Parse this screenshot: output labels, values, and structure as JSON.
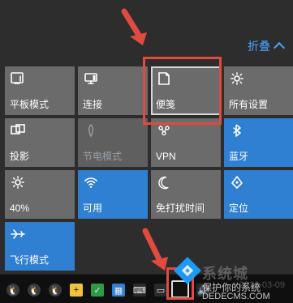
{
  "header": {
    "collapse_label": "折叠",
    "collapse_icon": "chevron-up-icon"
  },
  "tiles": [
    {
      "label": "平板模式",
      "icon": "tablet-mode-icon",
      "state": "normal"
    },
    {
      "label": "连接",
      "icon": "connect-icon",
      "state": "normal"
    },
    {
      "label": "便笺",
      "icon": "note-icon",
      "state": "highlight"
    },
    {
      "label": "所有设置",
      "icon": "settings-icon",
      "state": "normal"
    },
    {
      "label": "投影",
      "icon": "project-icon",
      "state": "normal"
    },
    {
      "label": "节电模式",
      "icon": "battery-saver-icon",
      "state": "disabled"
    },
    {
      "label": "VPN",
      "icon": "vpn-icon",
      "state": "normal"
    },
    {
      "label": "蓝牙",
      "icon": "bluetooth-icon",
      "state": "active"
    },
    {
      "label": "40%",
      "icon": "brightness-icon",
      "state": "normal"
    },
    {
      "label": "可用",
      "icon": "wifi-icon",
      "state": "active"
    },
    {
      "label": "免打扰时间",
      "icon": "quiet-hours-icon",
      "state": "normal"
    },
    {
      "label": "定位",
      "icon": "location-icon",
      "state": "active"
    },
    {
      "label": "飞行模式",
      "icon": "airplane-mode-icon",
      "state": "active"
    }
  ],
  "watermark": {
    "site_title": "系统城",
    "subtitle": "保护你的系统",
    "url": "DEDECMS.COM",
    "date_fragment": "2016-03-09"
  },
  "colors": {
    "accent_blue": "#2f7fd3",
    "highlight_red": "#e04a3f"
  }
}
